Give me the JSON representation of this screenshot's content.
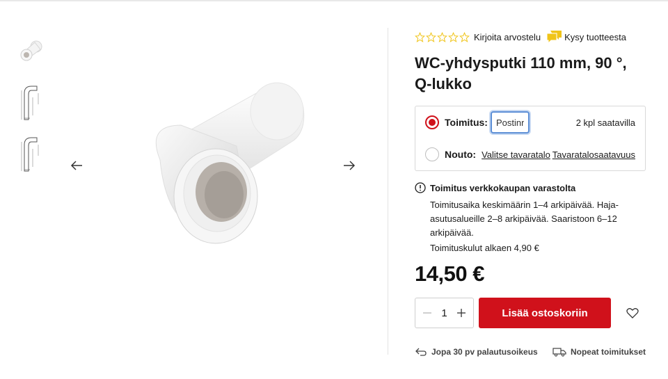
{
  "colors": {
    "accent": "#d0111b",
    "star": "#f0c419",
    "focus": "#5d8fd6"
  },
  "gallery": {
    "thumbnails": [
      {
        "icon": "pipe-photo-thumbnail"
      },
      {
        "icon": "technical-drawing-thumbnail"
      },
      {
        "icon": "technical-drawing-thumbnail"
      }
    ],
    "prev_icon": "arrow-left-icon",
    "next_icon": "arrow-right-icon"
  },
  "rating": {
    "stars_filled": 0,
    "stars_total": 5,
    "review_label": "Kirjoita arvostelu",
    "ask_label": "Kysy tuotteesta"
  },
  "product": {
    "title": "WC-yhdysputki 110 mm, 90 °, Q-lukko",
    "price": "14,50 €"
  },
  "delivery": {
    "shipping_label": "Toimitus:",
    "postal_placeholder": "Postinro",
    "availability": "2 kpl saatavilla",
    "pickup_label": "Nouto:",
    "choose_store": "Valitse tavaratalo",
    "store_stock": "Tavaratalosaatavuus"
  },
  "info": {
    "heading": "Toimitus verkkokaupan varastolta",
    "text": "Toimitusaika keskimäärin 1–4 arkipäivää. Haja-asutusalueille 2–8 arkipäivää. Saaristoon 6–12 arkipäivää.",
    "cost": "Toimituskulut alkaen 4,90 €"
  },
  "cart": {
    "quantity": "1",
    "add_label": "Lisää ostoskoriin"
  },
  "perks": {
    "returns": "Jopa 30 pv palautusoikeus",
    "fast": "Nopeat toimitukset"
  }
}
